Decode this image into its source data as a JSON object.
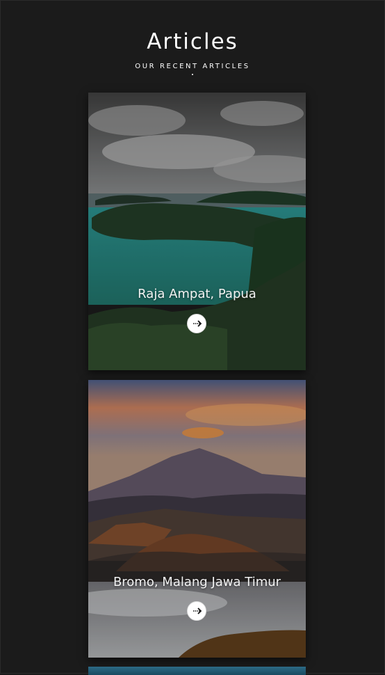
{
  "header": {
    "title": "Articles",
    "subtitle": "OUR RECENT ARTICLES"
  },
  "articles": [
    {
      "title": "Raja Ampat, Papua",
      "icon": "arrow-right-icon"
    },
    {
      "title": "Bromo, Malang Jawa Timur",
      "icon": "arrow-right-icon"
    }
  ],
  "colors": {
    "background": "#1b1b1b",
    "text": "#ffffff",
    "button": "#ffffff"
  }
}
